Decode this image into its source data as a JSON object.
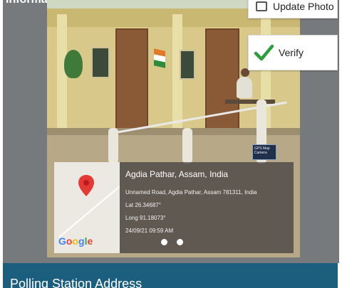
{
  "header": {
    "title": "Information"
  },
  "actions": {
    "update_photo_label": "Update Photo",
    "verify_label": "Verify"
  },
  "app_badge": {
    "text": "GPS Map Camera"
  },
  "geotag": {
    "title": "Agdia Pathar, Assam, India",
    "address": "Unnamed Road, Agdia Pathar, Assam 781311, India",
    "lat": "Lat 26.34687°",
    "long": "Long 91.18073°",
    "datetime": "24/09/21 09:59 AM",
    "map_brand": "Google"
  },
  "section": {
    "title": "Polling Station Address"
  },
  "colors": {
    "bar_blue": "#1b5e7e",
    "verify_green": "#2e9e3c",
    "pin_red": "#e53935"
  }
}
